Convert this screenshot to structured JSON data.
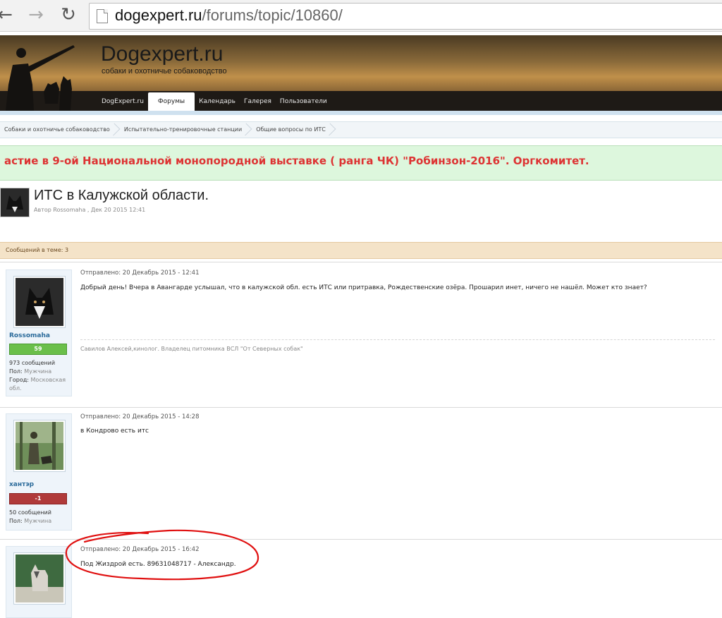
{
  "browser": {
    "url_host": "dogexpert.ru",
    "url_path": "/forums/topic/10860/"
  },
  "site": {
    "logo": "Dogexpert.ru",
    "tagline": "собаки и охотничье собаководство",
    "nav": [
      "DogExpert.ru",
      "Форумы",
      "Календарь",
      "Галерея",
      "Пользователи"
    ],
    "active_nav": "Форумы"
  },
  "breadcrumb": [
    "Собаки и охотничье собаководство",
    "Испытательно-тренировочные станции",
    "Общие вопросы по ИТС"
  ],
  "announcement": "астие в 9-ой Национальной монопородной выставке ( ранга ЧК) \"Робинзон-2016\". Оргкомитет.",
  "topic": {
    "title": "ИТС в Калужской области.",
    "meta": "Автор Rossomaha , Дек 20 2015 12:41",
    "post_count": "Сообщений в теме: 3"
  },
  "posts": [
    {
      "username": "Rossomaha",
      "reputation": "59",
      "messages": "973 сообщений",
      "gender_label": "Пол:",
      "gender": "Мужчина",
      "city_label": "Город:",
      "city": "Московская обл.",
      "date": "Отправлено: 20 Декабрь 2015 - 12:41",
      "body": "Добрый день! Вчера в Авангарде услышал, что в калужской обл. есть ИТС или притравка, Рождественские озёра. Прошарил инет, ничего не нашёл. Может кто знает?",
      "signature": "Савилов Алексей,кинолог. Владелец питомника ВСЛ \"От Северных собак\""
    },
    {
      "username": "хантэр",
      "reputation": "-1",
      "messages": "50 сообщений",
      "gender_label": "Пол:",
      "gender": "Мужчина",
      "date": "Отправлено: 20 Декабрь 2015 - 14:28",
      "body": "в Кондрово есть итс"
    },
    {
      "date": "Отправлено: 20 Декабрь 2015 - 16:42",
      "body": "Под Жиздрой есть. 89631048717 - Александр."
    }
  ],
  "colors": {
    "announcement_text": "#dd3333",
    "rep_positive": "#6abf4a",
    "rep_negative": "#b03a3a",
    "username": "#2a6a9a",
    "annotation_circle": "#e01010"
  }
}
